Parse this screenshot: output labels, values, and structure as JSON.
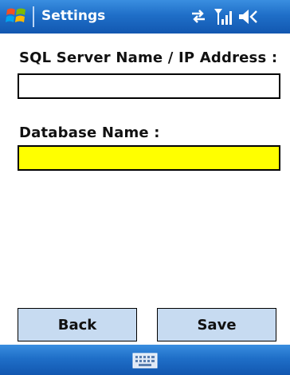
{
  "titlebar": {
    "title": "Settings",
    "icons": [
      "start-flag-icon",
      "connectivity-icon",
      "signal-icon",
      "volume-icon"
    ]
  },
  "form": {
    "server_label": "SQL Server Name / IP Address :",
    "server_value": "",
    "database_label": "Database Name :",
    "database_value": "",
    "database_field_color": "#ffff00"
  },
  "buttons": {
    "back_label": "Back",
    "save_label": "Save"
  },
  "bottombar": {
    "icon": "keyboard-icon"
  },
  "colors": {
    "titlebar": "#1f6fc8",
    "button_bg": "#c7dbf1"
  }
}
